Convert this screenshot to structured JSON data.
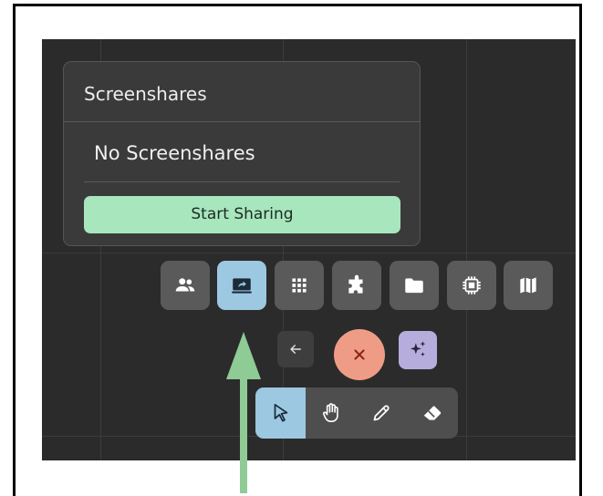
{
  "popup": {
    "title": "Screenshares",
    "empty_text": "No Screenshares",
    "start_button_label": "Start Sharing"
  },
  "toolbar": {
    "buttons": [
      {
        "name": "participants",
        "icon": "people-icon",
        "active": false
      },
      {
        "name": "screenshare",
        "icon": "screen-share-icon",
        "active": true
      },
      {
        "name": "apps",
        "icon": "grid-icon",
        "active": false
      },
      {
        "name": "plugins",
        "icon": "puzzle-icon",
        "active": false
      },
      {
        "name": "files",
        "icon": "folder-icon",
        "active": false
      },
      {
        "name": "processor",
        "icon": "chip-icon",
        "active": false
      },
      {
        "name": "map",
        "icon": "map-icon",
        "active": false
      }
    ]
  },
  "controls": {
    "back_icon": "arrow-left-icon",
    "close_icon": "close-icon",
    "ai_icon": "sparkles-icon"
  },
  "tools": [
    {
      "name": "select",
      "icon": "cursor-icon",
      "active": true
    },
    {
      "name": "pan",
      "icon": "hand-icon",
      "active": false
    },
    {
      "name": "draw",
      "icon": "pencil-icon",
      "active": false
    },
    {
      "name": "erase",
      "icon": "eraser-icon",
      "active": false
    }
  ],
  "colors": {
    "canvas": "#2b2b2b",
    "active_button": "#9cc8e2",
    "start_button": "#a8e6bd",
    "close_button": "#ef9c87",
    "ai_button": "#b7addd",
    "annotation_arrow": "#8fcb95"
  }
}
